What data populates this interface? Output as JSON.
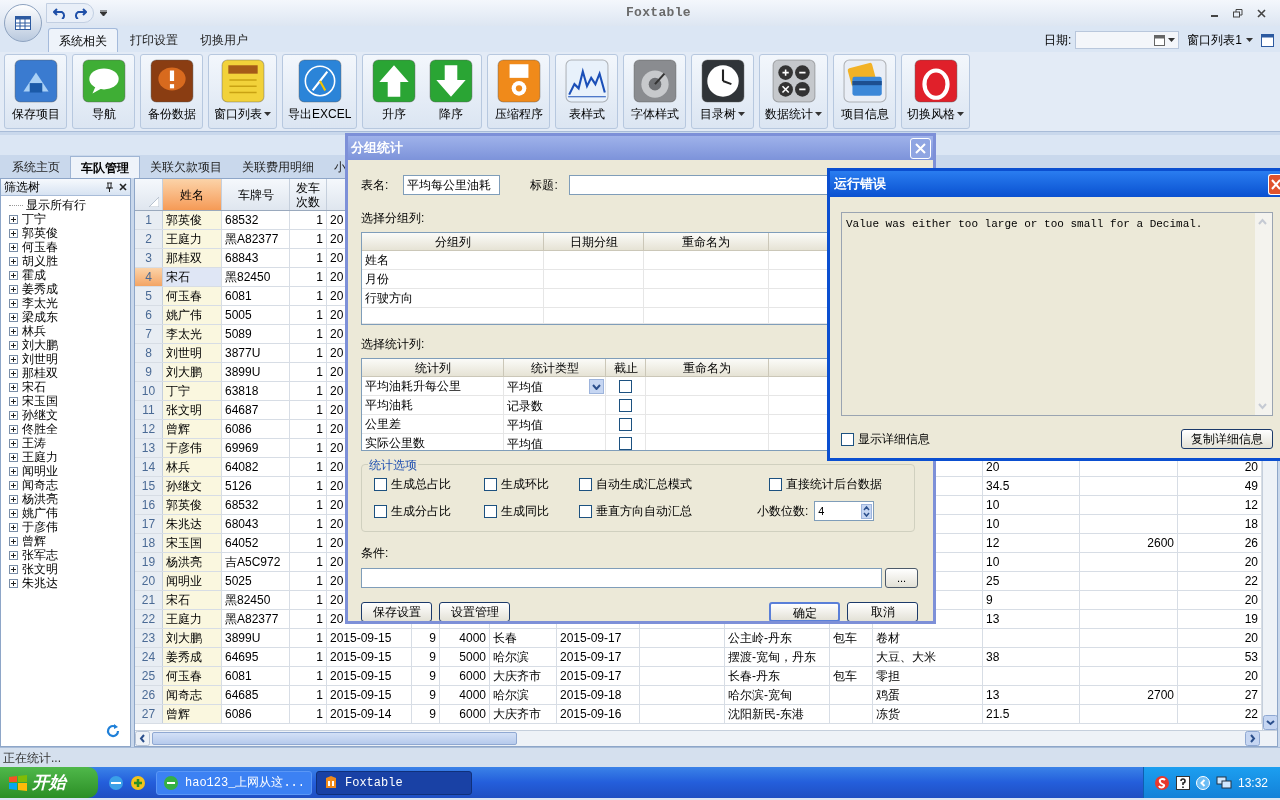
{
  "window": {
    "title": "Foxtable"
  },
  "ribbon": {
    "tabs": [
      {
        "label": "系统相关",
        "selected": true
      },
      {
        "label": "打印设置",
        "selected": false
      },
      {
        "label": "切换用户",
        "selected": false
      }
    ],
    "date_label": "日期:",
    "window_list": "窗口列表1",
    "groups": [
      [
        {
          "label": "保存项目",
          "dropdown": false
        }
      ],
      [
        {
          "label": "导航",
          "dropdown": false
        }
      ],
      [
        {
          "label": "备份数据",
          "dropdown": false
        }
      ],
      [
        {
          "label": "窗口列表",
          "dropdown": true
        }
      ],
      [
        {
          "label": "导出EXCEL",
          "dropdown": false
        }
      ],
      [
        {
          "label": "升序",
          "dropdown": false
        },
        {
          "label": "降序",
          "dropdown": false
        }
      ],
      [
        {
          "label": "压缩程序",
          "dropdown": false
        }
      ],
      [
        {
          "label": "表样式",
          "dropdown": false
        }
      ],
      [
        {
          "label": "字体样式",
          "dropdown": false
        }
      ],
      [
        {
          "label": "目录树",
          "dropdown": true
        }
      ],
      [
        {
          "label": "数据统计",
          "dropdown": true
        }
      ],
      [
        {
          "label": "项目信息",
          "dropdown": false
        }
      ],
      [
        {
          "label": "切换风格",
          "dropdown": true
        }
      ]
    ]
  },
  "doc_tabs": [
    {
      "label": "系统主页",
      "selected": false
    },
    {
      "label": "车队管理",
      "selected": true
    },
    {
      "label": "关联欠款项目",
      "selected": false
    },
    {
      "label": "关联费用明细",
      "selected": false
    },
    {
      "label": "小",
      "selected": false
    }
  ],
  "filter_panel": {
    "title": "筛选树",
    "show_all": "显示所有行",
    "items": [
      {
        "label": "丁宁",
        "expanded": false
      },
      {
        "label": "郭英俊",
        "expanded": false
      },
      {
        "label": "何玉春",
        "expanded": false
      },
      {
        "label": "胡义胜",
        "expanded": false
      },
      {
        "label": "霍成",
        "expanded": false
      },
      {
        "label": "姜秀成",
        "expanded": false
      },
      {
        "label": "李太光",
        "expanded": false
      },
      {
        "label": "梁成东",
        "expanded": false
      },
      {
        "label": "林兵",
        "expanded": false
      },
      {
        "label": "刘大鹏",
        "expanded": false
      },
      {
        "label": "刘世明",
        "expanded": false
      },
      {
        "label": "那桂双",
        "expanded": false
      },
      {
        "label": "宋石",
        "expanded": false
      },
      {
        "label": "宋玉国",
        "expanded": false
      },
      {
        "label": "孙继文",
        "expanded": false
      },
      {
        "label": "佟胜全",
        "expanded": false
      },
      {
        "label": "王涛",
        "expanded": false
      },
      {
        "label": "王庭力",
        "expanded": false
      },
      {
        "label": "闻明业",
        "expanded": false
      },
      {
        "label": "闻奇志",
        "expanded": false
      },
      {
        "label": "杨洪亮",
        "expanded": false
      },
      {
        "label": "姚广伟",
        "expanded": false
      },
      {
        "label": "于彦伟",
        "expanded": false
      },
      {
        "label": "曾辉",
        "expanded": false
      },
      {
        "label": "张军志",
        "expanded": false
      },
      {
        "label": "张文明",
        "expanded": false
      },
      {
        "label": "朱兆达",
        "expanded": false
      }
    ]
  },
  "table": {
    "columns": [
      {
        "label": "姓名",
        "selected": true
      },
      {
        "label": "车牌号",
        "selected": false
      },
      {
        "label": "发车次数",
        "selected": false
      }
    ],
    "rows": [
      {
        "number": "1",
        "selected": false,
        "cells": [
          "郭英俊",
          "68532",
          "1",
          "20"
        ]
      },
      {
        "number": "2",
        "selected": false,
        "cells": [
          "王庭力",
          "黑A82377",
          "1",
          "20"
        ]
      },
      {
        "number": "3",
        "selected": false,
        "cells": [
          "那桂双",
          "68843",
          "1",
          "20"
        ]
      },
      {
        "number": "4",
        "selected": true,
        "cells": [
          "宋石",
          "黑82450",
          "1",
          "20"
        ]
      },
      {
        "number": "5",
        "selected": false,
        "cells": [
          "何玉春",
          "6081",
          "1",
          "20"
        ]
      },
      {
        "number": "6",
        "selected": false,
        "cells": [
          "姚广伟",
          "5005",
          "1",
          "20"
        ]
      },
      {
        "number": "7",
        "selected": false,
        "cells": [
          "李太光",
          "5089",
          "1",
          "20"
        ]
      },
      {
        "number": "8",
        "selected": false,
        "cells": [
          "刘世明",
          "3877U",
          "1",
          "20"
        ]
      },
      {
        "number": "9",
        "selected": false,
        "cells": [
          "刘大鹏",
          "3899U",
          "1",
          "20"
        ]
      },
      {
        "number": "10",
        "selected": false,
        "cells": [
          "丁宁",
          "63818",
          "1",
          "20"
        ]
      },
      {
        "number": "11",
        "selected": false,
        "cells": [
          "张文明",
          "64687",
          "1",
          "20"
        ]
      },
      {
        "number": "12",
        "selected": false,
        "cells": [
          "曾辉",
          "6086",
          "1",
          "20"
        ]
      },
      {
        "number": "13",
        "selected": false,
        "cells": [
          "于彦伟",
          "69969",
          "1",
          "20"
        ]
      },
      {
        "number": "14",
        "selected": false,
        "cells": [
          "林兵",
          "64082",
          "1",
          "20",
          null,
          null,
          null,
          null,
          null,
          null,
          null,
          null,
          "20",
          null,
          "20"
        ]
      },
      {
        "number": "15",
        "selected": false,
        "cells": [
          "孙继文",
          "5126",
          "1",
          "20",
          null,
          null,
          null,
          null,
          null,
          null,
          null,
          null,
          "34.5",
          null,
          "49"
        ]
      },
      {
        "number": "16",
        "selected": false,
        "cells": [
          "郭英俊",
          "68532",
          "1",
          "20",
          null,
          null,
          null,
          null,
          null,
          null,
          null,
          null,
          "10",
          null,
          "12"
        ]
      },
      {
        "number": "17",
        "selected": false,
        "cells": [
          "朱兆达",
          "68043",
          "1",
          "20",
          null,
          null,
          null,
          null,
          null,
          null,
          null,
          null,
          "10",
          null,
          "18"
        ]
      },
      {
        "number": "18",
        "selected": false,
        "cells": [
          "宋玉国",
          "64052",
          "1",
          "20",
          null,
          null,
          null,
          null,
          null,
          null,
          null,
          null,
          "12",
          "2600",
          "26"
        ]
      },
      {
        "number": "19",
        "selected": false,
        "cells": [
          "杨洪亮",
          "吉A5C972",
          "1",
          "20",
          null,
          null,
          null,
          null,
          null,
          null,
          null,
          null,
          "10",
          null,
          "20"
        ]
      },
      {
        "number": "20",
        "selected": false,
        "cells": [
          "闻明业",
          "5025",
          "1",
          "20",
          null,
          null,
          null,
          null,
          null,
          null,
          null,
          null,
          "25",
          null,
          "22"
        ]
      },
      {
        "number": "21",
        "selected": false,
        "cells": [
          "宋石",
          "黑82450",
          "1",
          "20",
          null,
          null,
          null,
          null,
          null,
          null,
          null,
          null,
          "9",
          null,
          "20"
        ]
      },
      {
        "number": "22",
        "selected": false,
        "cells": [
          "王庭力",
          "黑A82377",
          "1",
          "20",
          null,
          null,
          null,
          null,
          null,
          null,
          null,
          null,
          "13",
          null,
          "19"
        ]
      },
      {
        "number": "23",
        "selected": false,
        "cells": [
          "刘大鹏",
          "3899U",
          "1",
          "2015-09-15",
          "9",
          "4000",
          "长春",
          "2015-09-17",
          null,
          "公主岭-丹东",
          "包车",
          "卷材",
          null,
          null,
          "20"
        ]
      },
      {
        "number": "24",
        "selected": false,
        "cells": [
          "姜秀成",
          "64695",
          "1",
          "2015-09-15",
          "9",
          "5000",
          "哈尔滨",
          "2015-09-17",
          null,
          "摆渡-宽甸，丹东",
          null,
          "大豆、大米",
          "38",
          null,
          "53"
        ]
      },
      {
        "number": "25",
        "selected": false,
        "cells": [
          "何玉春",
          "6081",
          "1",
          "2015-09-15",
          "9",
          "6000",
          "大庆齐市",
          "2015-09-17",
          null,
          "长春-丹东",
          "包车",
          "零担",
          null,
          null,
          "20"
        ]
      },
      {
        "number": "26",
        "selected": false,
        "cells": [
          "闻奇志",
          "64685",
          "1",
          "2015-09-15",
          "9",
          "4000",
          "哈尔滨",
          "2015-09-18",
          null,
          "哈尔滨-宽甸",
          null,
          "鸡蛋",
          "13",
          "2700",
          "27"
        ]
      },
      {
        "number": "27",
        "selected": false,
        "cells": [
          "曾辉",
          "6086",
          "1",
          "2015-09-14",
          "9",
          "6000",
          "大庆齐市",
          "2015-09-16",
          null,
          "沈阳新民-东港",
          null,
          "冻货",
          "21.5",
          null,
          "22"
        ]
      }
    ]
  },
  "status_bar": "正在统计...",
  "group_dialog": {
    "title": "分组统计",
    "table_name_label": "表名:",
    "table_name": "平均每公里油耗",
    "caption_label": "标题:",
    "group_label": "选择分组列:",
    "group_columns": [
      "分组列",
      "日期分组",
      "重命名为"
    ],
    "group_rows": [
      "姓名",
      "月份",
      "行驶方向"
    ],
    "stat_label": "选择统计列:",
    "stat_columns": [
      "统计列",
      "统计类型",
      "截止",
      "重命名为"
    ],
    "stat_rows": [
      {
        "column": "平均油耗升每公里",
        "type": "平均值",
        "cutoff": false,
        "dropdown": true
      },
      {
        "column": "平均油耗",
        "type": "记录数",
        "cutoff": false,
        "dropdown": false
      },
      {
        "column": "公里差",
        "type": "平均值",
        "cutoff": false,
        "dropdown": false
      },
      {
        "column": "实际公里数",
        "type": "平均值",
        "cutoff": false,
        "dropdown": false
      }
    ],
    "options_legend": "统计选项",
    "options": [
      {
        "label": "生成总占比",
        "checked": false
      },
      {
        "label": "生成环比",
        "checked": false
      },
      {
        "label": "自动生成汇总模式",
        "checked": false
      },
      {
        "label": "直接统计后台数据",
        "checked": false
      },
      {
        "label": "生成分占比",
        "checked": false
      },
      {
        "label": "生成同比",
        "checked": false
      },
      {
        "label": "垂直方向自动汇总",
        "checked": false
      }
    ],
    "decimals_label": "小数位数:",
    "decimals": "4",
    "condition_label": "条件:",
    "browse": "...",
    "buttons": [
      {
        "label": "保存设置",
        "default": false
      },
      {
        "label": "设置管理",
        "default": false
      },
      {
        "label": "确定",
        "default": true
      },
      {
        "label": "取消",
        "default": false
      }
    ]
  },
  "error_dialog": {
    "title": "运行错误",
    "message": "Value was either too large or too small for a Decimal.",
    "details_label": "显示详细信息",
    "details_checked": false,
    "copy_button": "复制详细信息"
  },
  "taskbar": {
    "start": "开始",
    "tasks": [
      {
        "label": "hao123_上网从这...",
        "selected": false
      },
      {
        "label": "Foxtable",
        "selected": true
      }
    ],
    "clock": "13:32"
  }
}
